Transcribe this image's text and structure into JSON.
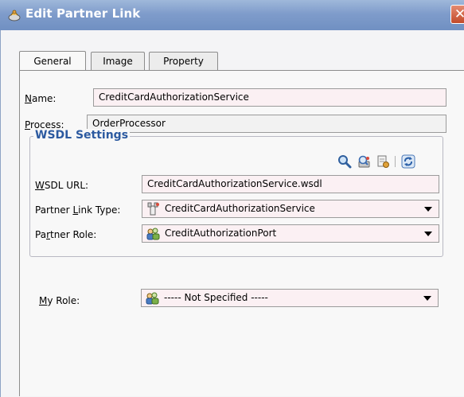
{
  "window": {
    "title": "Edit Partner Link",
    "close_glyph": "✕"
  },
  "tabs": [
    {
      "label": "General",
      "selected": true
    },
    {
      "label": "Image",
      "selected": false
    },
    {
      "label": "Property",
      "selected": false
    }
  ],
  "general": {
    "name_label_mnemonic": "N",
    "name_label_rest": "ame:",
    "name_value": "CreditCardAuthorizationService",
    "process_label_mnemonic": "P",
    "process_label_rest": "rocess:",
    "process_value": "OrderProcessor"
  },
  "wsdl_settings": {
    "legend": "WSDL Settings",
    "toolbar_icons": [
      "search-icon",
      "service-explorer-icon",
      "create-wsdl-icon",
      "refresh-icon"
    ],
    "wsdl_url_label_mnemonic": "W",
    "wsdl_url_label_rest": "SDL URL:",
    "wsdl_url_value": "CreditCardAuthorizationService.wsdl",
    "partner_link_type_label_a": "Partner ",
    "partner_link_type_label_mnemonic": "L",
    "partner_link_type_label_b": "ink Type:",
    "partner_link_type_value": "CreditCardAuthorizationService",
    "partner_role_label_a": "Pa",
    "partner_role_label_mnemonic": "r",
    "partner_role_label_b": "tner Role:",
    "partner_role_value": "CreditAuthorizationPort",
    "my_role_label_mnemonic": "M",
    "my_role_label_rest": "y Role:",
    "my_role_value": "----- Not Specified -----"
  },
  "colors": {
    "title_bar": "#7f9ccb",
    "legend_text": "#2c5aa0",
    "field_bg": "#fbf0f3"
  }
}
